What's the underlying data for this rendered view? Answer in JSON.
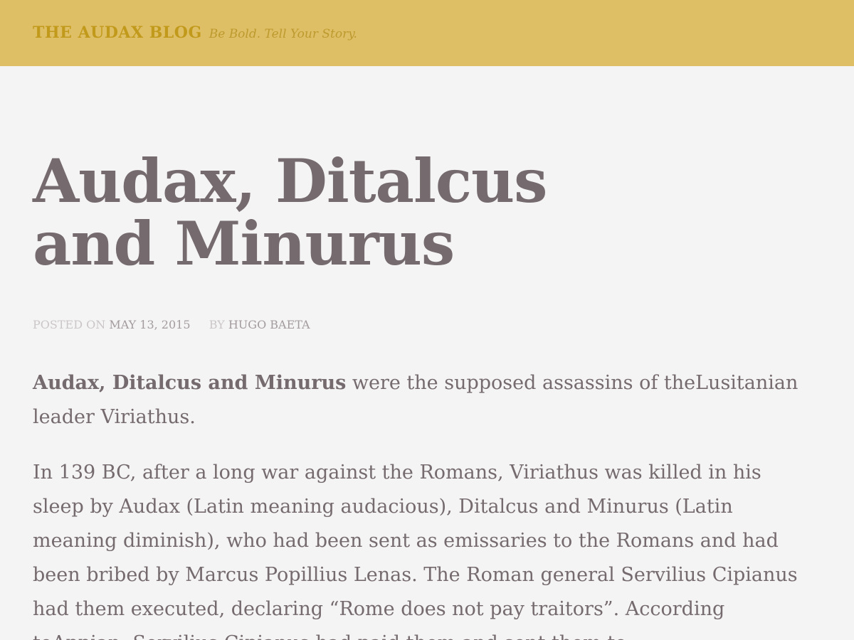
{
  "header": {
    "site_title": "THE AUDAX BLOG",
    "tagline": "Be Bold. Tell Your Story."
  },
  "post": {
    "title_line1": "Audax, Ditalcus",
    "title_line2": "and Minurus",
    "meta": {
      "posted_label": "POSTED ON",
      "date": "MAY 13, 2015",
      "by_label": "BY",
      "author": "HUGO BAETA"
    },
    "paragraphs": [
      {
        "bold": "Audax, Ditalcus and Minurus",
        "text": " were the supposed assassins of theLusitanian leader Viriathus."
      },
      {
        "text": "In 139 BC, after a long war against the Romans, Viriathus was killed in his sleep by Audax (Latin meaning audacious), Ditalcus and Minurus (Latin meaning diminish), who had been sent as emissaries to the Romans and had been bribed by Marcus Popillius Lenas. The Roman general Servilius Cipianus had them executed, declaring “Rome does not pay traitors”. According toAppian, Servilius Cipianus had paid them and sent them to"
      }
    ]
  },
  "colors": {
    "header_bg": "#dfbf66",
    "site_title": "#c29a1b",
    "page_bg": "#f4f4f4",
    "text": "#756a6d",
    "meta_label": "#cbc6c7",
    "meta_value": "#a39b9d"
  }
}
